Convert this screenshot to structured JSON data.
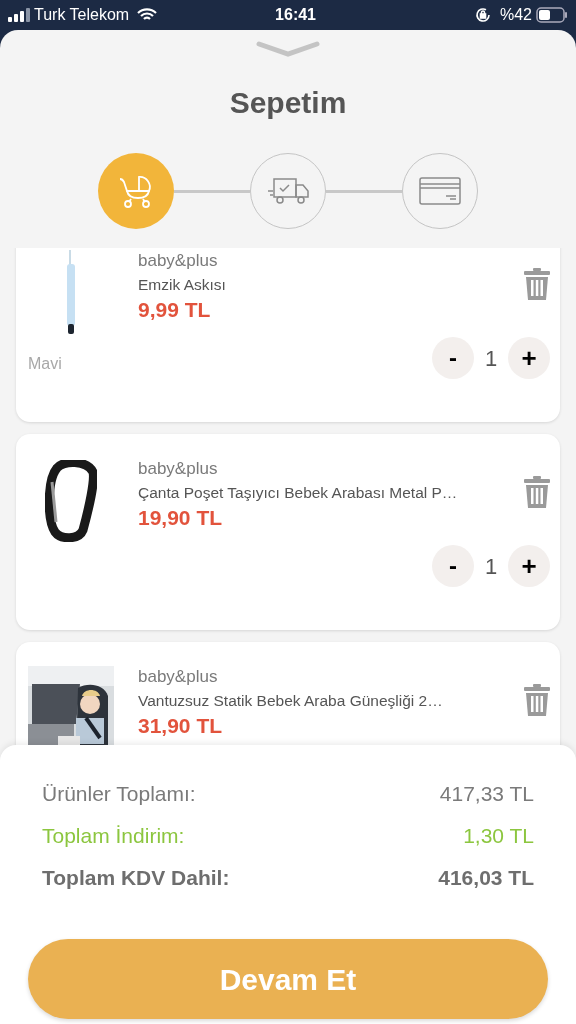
{
  "status_bar": {
    "carrier": "Turk Telekom",
    "time": "16:41",
    "battery": "%42"
  },
  "title": "Sepetim",
  "steps": [
    {
      "kind": "stroller",
      "selected": true
    },
    {
      "kind": "truck",
      "selected": false
    },
    {
      "kind": "card",
      "selected": false
    }
  ],
  "items": [
    {
      "kind": "pacifier",
      "brand": "baby&plus",
      "name": "Emzik Askısı",
      "price": "9,99 TL",
      "variant": "Mavi",
      "minus": "-",
      "quantity": "1",
      "plus": "+"
    },
    {
      "kind": "carabiner",
      "brand": "baby&plus",
      "name": "Çanta Poşet Taşıyıcı Bebek Arabası Metal P…",
      "price": "19,90 TL",
      "minus": "-",
      "quantity": "1",
      "plus": "+"
    },
    {
      "kind": "picture",
      "brand": "baby&plus",
      "name": "Vantuzsuz Statik Bebek Araba Güneşliği 2…",
      "price": "31,90 TL"
    }
  ],
  "summary": [
    {
      "kind": "normal",
      "label": "Ürünler Toplamı:",
      "value": "417,33 TL"
    },
    {
      "kind": "discount",
      "label": "Toplam İndirim:",
      "value": "1,30 TL"
    },
    {
      "kind": "total",
      "label": "Toplam KDV Dahil:",
      "value": "416,03 TL"
    }
  ],
  "continue_button": "Devam Et"
}
